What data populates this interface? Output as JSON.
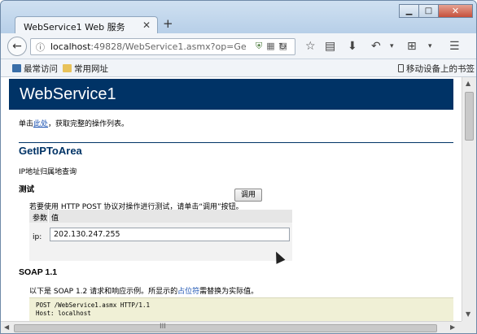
{
  "browser": {
    "tab_title": "WebService1 Web 服务",
    "tab_close": "✕",
    "new_tab": "+",
    "window_buttons": {
      "minimize": "▁",
      "maximize": "□",
      "close": "✕"
    },
    "url_host": "localhost",
    "url_rest": ":49828/WebService1.asmx?op=Ge",
    "toolbar_icons": [
      "star-icon",
      "reader-icon",
      "download-icon",
      "undo-icon",
      "dropdown-icon",
      "crop-icon",
      "menu-icon"
    ],
    "bookmarks": {
      "most_visited": "最常访问",
      "common_sites": "常用网址",
      "mobile_bookmarks": "移动设备上的书签"
    }
  },
  "page": {
    "service_title": "WebService1",
    "intro_prefix": "单击",
    "intro_link": "此处",
    "intro_suffix": "，获取完整的操作列表。",
    "operation_title": "GetIPToArea",
    "operation_desc": "IP地址归属地查询",
    "test_heading": "测试",
    "test_desc": "若要使用 HTTP POST 协议对操作进行测试，请单击“调用”按钮。",
    "param_header": "参数",
    "value_header": "值",
    "param_name": "ip:",
    "param_value": "202.130.247.255",
    "invoke_button": "调用",
    "soap_title": "SOAP 1.1",
    "soap_desc_prefix": "以下是 SOAP 1.2 请求和响应示例。所显示的",
    "soap_desc_link": "占位符",
    "soap_desc_suffix": "需替换为实际值。",
    "code_line1": "POST /WebService1.asmx HTTP/1.1",
    "code_line2": "Host: localhost"
  },
  "scrollbar": {
    "grip": "III"
  }
}
